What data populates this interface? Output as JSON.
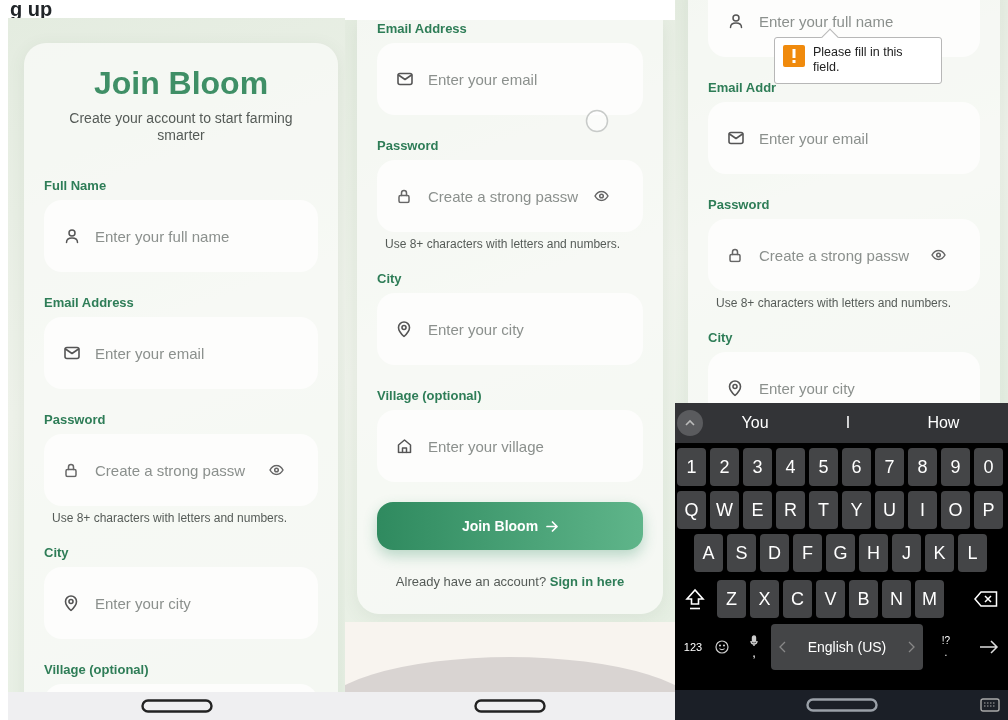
{
  "caption": "g up",
  "screens": [
    {
      "kind": "top",
      "items": [
        {
          "kind": "heading",
          "text": "Join Bloom"
        },
        {
          "kind": "subtitle",
          "text": "Create your account to start farming smarter"
        },
        {
          "kind": "name",
          "label": "Full Name",
          "placeholder": "Enter your full name"
        },
        {
          "kind": "email",
          "label": "Email Address",
          "placeholder": "Enter your email"
        },
        {
          "kind": "password",
          "label": "Password",
          "placeholder": "Create a strong passw",
          "reveal": true
        },
        {
          "kind": "hint",
          "text": "Use 8+ characters with letters and numbers."
        },
        {
          "kind": "city",
          "label": "City",
          "placeholder": "Enter your city"
        },
        {
          "kind": "village",
          "label": "Village (optional)"
        }
      ]
    },
    {
      "kind": "middle",
      "items": [
        {
          "kind": "email",
          "label": "Email Address",
          "placeholder": "Enter your email"
        },
        {
          "kind": "password",
          "label": "Password",
          "placeholder": "Create a strong passw",
          "reveal": true
        },
        {
          "kind": "hint",
          "text": "Use 8+ characters with letters and numbers."
        },
        {
          "kind": "city",
          "label": "City",
          "placeholder": "Enter your city"
        },
        {
          "kind": "village",
          "label": "Village (optional)",
          "placeholder": "Enter your village"
        },
        {
          "kind": "button",
          "text": "Join Bloom"
        },
        {
          "kind": "signin",
          "text": "Already have an account?",
          "link": "Sign in here"
        }
      ]
    },
    {
      "kind": "keyboard",
      "items": [
        {
          "kind": "name",
          "placeholder": "Enter your full name",
          "tooltip": "Please fill in this field."
        },
        {
          "kind": "email",
          "label": "Email Addr",
          "placeholder": "Enter your email"
        },
        {
          "kind": "password",
          "label": "Password",
          "placeholder": "Create a strong passw",
          "reveal": true
        },
        {
          "kind": "hint",
          "text": "Use 8+ characters with letters and numbers."
        },
        {
          "kind": "city",
          "label": "City",
          "placeholder": "Enter your city"
        }
      ],
      "keyboard": {
        "suggestions": [
          "You",
          "I",
          "How"
        ],
        "rows": [
          {
            "kind": "plain",
            "keys": [
              "1",
              "2",
              "3",
              "4",
              "5",
              "6",
              "7",
              "8",
              "9",
              "0"
            ]
          },
          {
            "kind": "plain",
            "keys": [
              "Q",
              "W",
              "E",
              "R",
              "T",
              "Y",
              "U",
              "I",
              "O",
              "P"
            ]
          },
          {
            "kind": "plain",
            "keys": [
              "A",
              "S",
              "D",
              "F",
              "G",
              "H",
              "J",
              "K",
              "L"
            ]
          },
          {
            "kind": "shift",
            "keys": [
              "Z",
              "X",
              "C",
              "V",
              "B",
              "N",
              "M"
            ]
          }
        ],
        "mode_key": "123",
        "comma": ",",
        "space": "English (US)",
        "period": ".",
        "period_alt": "!?"
      }
    }
  ]
}
